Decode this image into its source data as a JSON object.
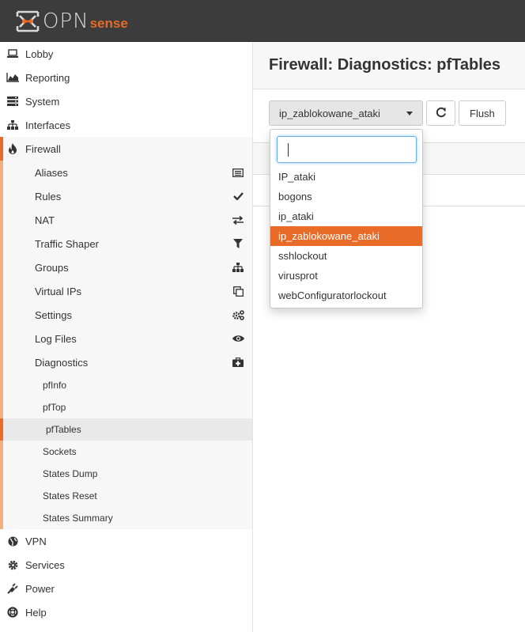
{
  "brand": {
    "logo_main": "OPN",
    "logo_accent": "sense",
    "accent_color": "#e86b27"
  },
  "sidebar": {
    "top_items": [
      {
        "label": "Lobby",
        "icon": "laptop-icon"
      },
      {
        "label": "Reporting",
        "icon": "area-chart-icon"
      },
      {
        "label": "System",
        "icon": "server-icon"
      },
      {
        "label": "Interfaces",
        "icon": "sitemap-icon"
      }
    ],
    "firewall": {
      "label": "Firewall",
      "icon": "fire-icon"
    },
    "firewall_items": [
      {
        "label": "Aliases",
        "icon": "list-alt-icon"
      },
      {
        "label": "Rules",
        "icon": "check-icon"
      },
      {
        "label": "NAT",
        "icon": "exchange-icon"
      },
      {
        "label": "Traffic Shaper",
        "icon": "filter-icon"
      },
      {
        "label": "Groups",
        "icon": "sitemap-icon"
      },
      {
        "label": "Virtual IPs",
        "icon": "clone-icon"
      },
      {
        "label": "Settings",
        "icon": "cogs-icon"
      },
      {
        "label": "Log Files",
        "icon": "eye-icon"
      },
      {
        "label": "Diagnostics",
        "icon": "medkit-icon"
      }
    ],
    "diagnostics_items": [
      "pfInfo",
      "pfTop",
      "pfTables",
      "Sockets",
      "States Dump",
      "States Reset",
      "States Summary"
    ],
    "diagnostics_selected": "pfTables",
    "bottom_items": [
      {
        "label": "VPN",
        "icon": "globe-icon"
      },
      {
        "label": "Services",
        "icon": "cog-icon"
      },
      {
        "label": "Power",
        "icon": "plug-icon"
      },
      {
        "label": "Help",
        "icon": "life-ring-icon"
      }
    ]
  },
  "main": {
    "title": "Firewall: Diagnostics: pfTables",
    "selected_table": "ip_zablokowane_ataki",
    "refresh_icon": "refresh-icon",
    "flush_label": "Flush"
  },
  "dropdown": {
    "search_value": "",
    "options": [
      "IP_ataki",
      "bogons",
      "ip_ataki",
      "ip_zablokowane_ataki",
      "sshlockout",
      "virusprot",
      "webConfiguratorlockout"
    ],
    "selected": "ip_zablokowane_ataki"
  }
}
